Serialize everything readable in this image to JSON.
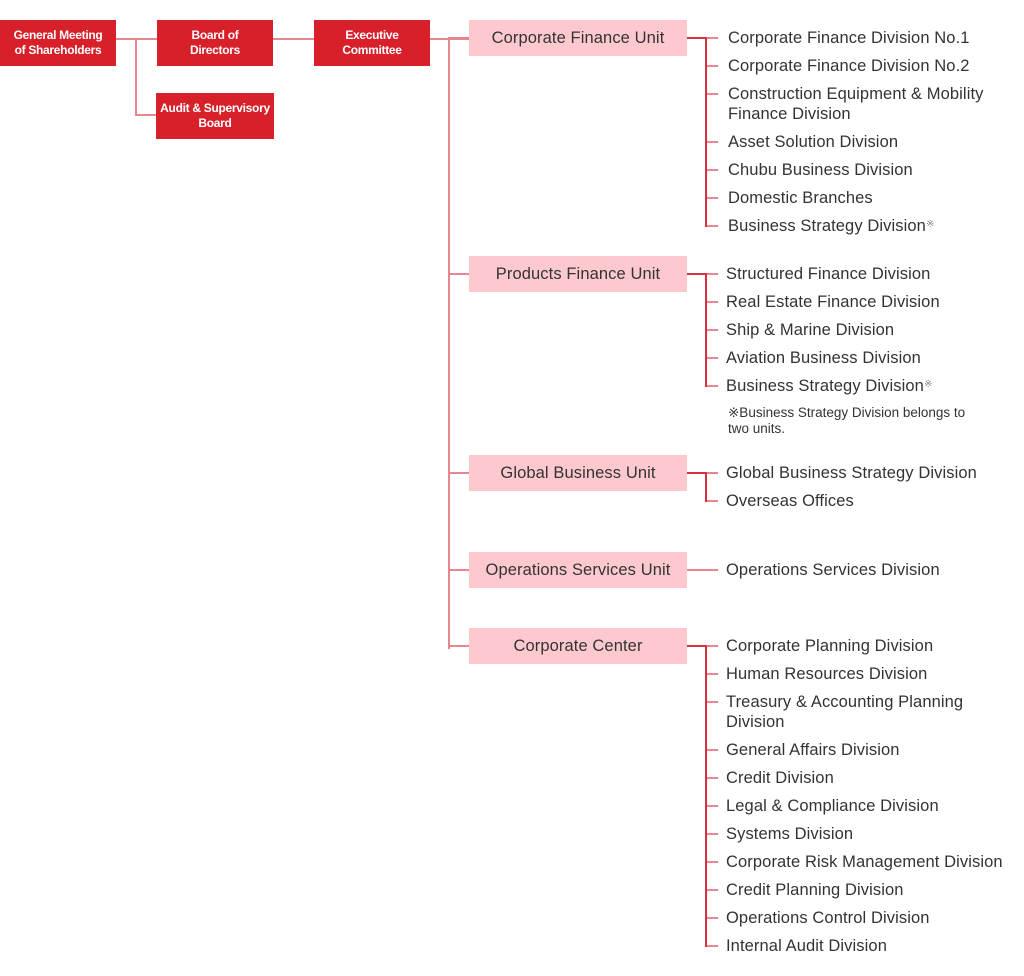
{
  "colors": {
    "top_box": "#d7202a",
    "unit_box": "#fdc9cf",
    "connector": "#e8868f",
    "connector_dark": "#d7303e",
    "text": "#333333"
  },
  "top": {
    "shareholders": "General Meeting\nof Shareholders",
    "board": "Board of\nDirectors",
    "audit": "Audit & Supervisory\nBoard",
    "executive": "Executive\nCommittee"
  },
  "units": [
    {
      "name": "Corporate Finance Unit",
      "divisions": [
        "Corporate Finance Division No.1",
        "Corporate Finance Division No.2",
        "Construction Equipment & Mobility\nFinance Division",
        "Asset Solution Division",
        "Chubu Business Division",
        "Domestic Branches",
        "Business Strategy Division"
      ]
    },
    {
      "name": "Products Finance Unit",
      "divisions": [
        "Structured Finance Division",
        "Real Estate Finance Division",
        "Ship & Marine Division",
        "Aviation Business Division",
        "Business Strategy Division"
      ]
    },
    {
      "name": "Global Business Unit",
      "divisions": [
        "Global Business Strategy Division",
        "Overseas Offices"
      ]
    },
    {
      "name": "Operations Services Unit",
      "divisions": [
        "Operations Services Division"
      ]
    },
    {
      "name": "Corporate Center",
      "divisions": [
        "Corporate Planning Division",
        "Human Resources Division",
        "Treasury & Accounting Planning\nDivision",
        "General Affairs Division",
        "Credit Division",
        "Legal & Compliance Division",
        "Systems Division",
        "Corporate Risk Management Division",
        "Credit Planning Division",
        "Operations Control Division",
        "Internal Audit Division"
      ]
    }
  ],
  "note_mark": "※",
  "note": "※Business Strategy Division belongs to\ntwo units."
}
